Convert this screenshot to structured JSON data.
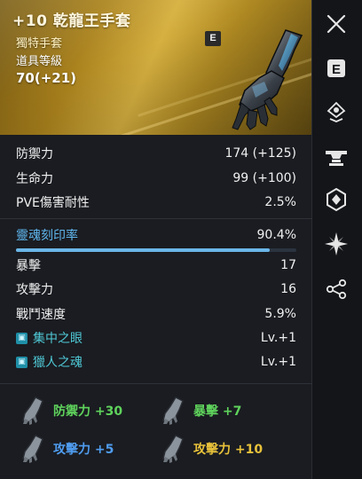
{
  "item": {
    "name": "+10 乾龍王手套",
    "grade": "獨特手套",
    "level_label": "道具等級",
    "level_value": "70(+21)",
    "badge": "E"
  },
  "stats": [
    {
      "label": "防禦力",
      "value": "174 (+125)"
    },
    {
      "label": "生命力",
      "value": "99 (+100)"
    },
    {
      "label": "PVE傷害耐性",
      "value": "2.5%"
    }
  ],
  "soul": {
    "label": "靈魂刻印率",
    "value": "90.4%",
    "fill_fraction": 0.904
  },
  "sub_stats": [
    {
      "label": "暴擊",
      "value": "17"
    },
    {
      "label": "攻擊力",
      "value": "16"
    },
    {
      "label": "戰鬥速度",
      "value": "5.9%"
    }
  ],
  "skills": [
    {
      "label": "集中之眼",
      "value": "Lv.+1"
    },
    {
      "label": "獵人之魂",
      "value": "Lv.+1"
    }
  ],
  "bonuses": [
    {
      "label": "防禦力 +30",
      "color": "#5fd35c"
    },
    {
      "label": "暴擊 +7",
      "color": "#5fd35c"
    },
    {
      "label": "攻擊力 +5",
      "color": "#4f9cf0"
    },
    {
      "label": "攻擊力 +10",
      "color": "#e8c23a"
    }
  ],
  "sidebar": {
    "icons": [
      "close-icon",
      "e-grade-icon",
      "location-pin-icon",
      "anvil-icon",
      "soul-crest-icon",
      "compass-star-icon",
      "share-icon"
    ],
    "e_letter": "E"
  },
  "colors": {
    "header_gold": "#b08a22",
    "soul_blue": "#5fb6ee",
    "skill_teal": "#4fc9d6"
  }
}
